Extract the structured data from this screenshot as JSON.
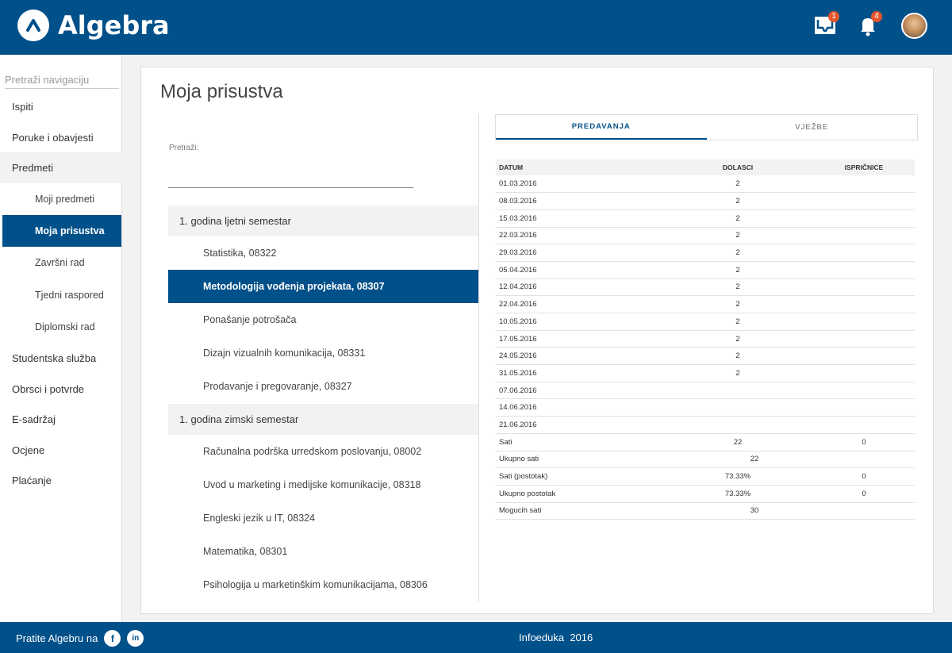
{
  "header": {
    "brand": "Algebra",
    "inbox_badge": "1",
    "notifications_badge": "4"
  },
  "sidebar": {
    "search_placeholder": "Pretraži navigaciju",
    "items": [
      {
        "label": "Ispiti"
      },
      {
        "label": "Poruke i obavjesti"
      },
      {
        "label": "Predmeti"
      },
      {
        "label": "Moji predmeti"
      },
      {
        "label": "Moja prisustva"
      },
      {
        "label": "Završni rad"
      },
      {
        "label": "Tjedni raspored"
      },
      {
        "label": "Diplomski rad"
      },
      {
        "label": "Studentska služba"
      },
      {
        "label": "Obrsci i potvrde"
      },
      {
        "label": "E-sadržaj"
      },
      {
        "label": "Ocjene"
      },
      {
        "label": "Plaćanje"
      }
    ]
  },
  "main": {
    "title": "Moja prisustva",
    "search_label": "Pretraži:",
    "semesters": [
      {
        "title": "1. godina ljetni semestar",
        "courses": [
          "Statistika, 08322",
          "Metodologija vođenja projekata, 08307",
          "Ponašanje potrošača",
          "Dizajn vizualnih komunikacija, 08331",
          "Prodavanje i pregovaranje, 08327"
        ]
      },
      {
        "title": "1. godina zimski semestar",
        "courses": [
          "Računalna podrška urredskom poslovanju, 08002",
          "Uvod u marketing i medijske komunikacije, 08318",
          "Engleski jezik u IT, 08324",
          "Matematika, 08301",
          "Psihologija u marketinškim komunikacijama, 08306"
        ]
      }
    ]
  },
  "attendance": {
    "tabs": [
      "PREDAVANJA",
      "VJEŽBE"
    ],
    "columns": [
      "DATUM",
      "DOLASCI",
      "ISPRIČNICE"
    ],
    "rows": [
      [
        "01.03.2016",
        "2",
        ""
      ],
      [
        "08.03.2016",
        "2",
        ""
      ],
      [
        "15.03.2016",
        "2",
        ""
      ],
      [
        "22.03.2016",
        "2",
        ""
      ],
      [
        "29.03.2016",
        "2",
        ""
      ],
      [
        "05.04.2016",
        "2",
        ""
      ],
      [
        "12.04.2016",
        "2",
        ""
      ],
      [
        "22.04.2016",
        "2",
        ""
      ],
      [
        "10.05.2016",
        "2",
        ""
      ],
      [
        "17.05.2016",
        "2",
        ""
      ],
      [
        "24.05.2016",
        "2",
        ""
      ],
      [
        "31.05.2016",
        "2",
        ""
      ],
      [
        "07.06.2016",
        "",
        ""
      ],
      [
        "14.06.2016",
        "",
        ""
      ],
      [
        "21.06.2016",
        "",
        ""
      ]
    ],
    "summary": [
      {
        "label": "Sati",
        "dolasci": "22",
        "ispricnice": "0"
      },
      {
        "label": "Ukupno sati",
        "total": "22"
      },
      {
        "label": "Sati (postotak)",
        "dolasci": "73.33%",
        "ispricnice": "0"
      },
      {
        "label": "Ukupno postotak",
        "dolasci": "73.33%",
        "ispricnice": "0"
      },
      {
        "label": "Mogucih sati",
        "total": "30"
      }
    ]
  },
  "footer": {
    "follow_text": "Pratite Algebru na",
    "facebook_glyph": "f",
    "linkedin_glyph": "in",
    "copyright": "Infoeduka  2016"
  },
  "colors": {
    "brand": "#00508a",
    "badge": "#e4572e"
  }
}
